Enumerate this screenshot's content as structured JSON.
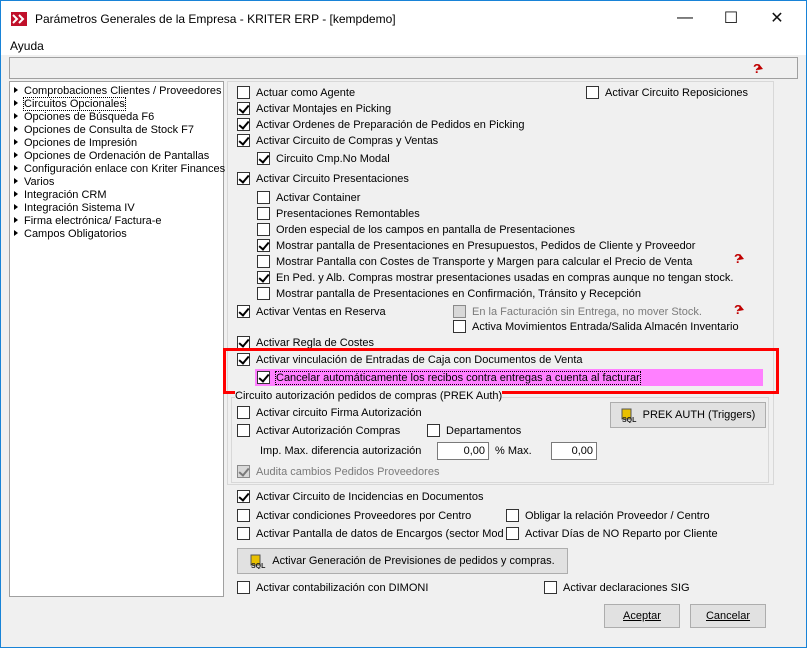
{
  "window": {
    "title": "Parámetros Generales de la Empresa - KRITER ERP - [kempdemo]",
    "minimize": "—",
    "maximize": "☐",
    "close": "✕"
  },
  "menu": {
    "ayuda": "Ayuda"
  },
  "tree": {
    "items": [
      "Comprobaciones Clientes / Proveedores",
      "Circuitos Opcionales",
      "Opciones de Búsqueda F6",
      "Opciones de Consulta de Stock F7",
      "Opciones de Impresión",
      "Opciones de Ordenación de Pantallas",
      "Configuración enlace con Kriter Finances",
      "Varios",
      "Integración CRM",
      "Integración Sistema IV",
      "Firma electrónica/ Factura-e",
      "Campos Obligatorios"
    ],
    "selected_index": 1
  },
  "options": {
    "actuar_agente": "Actuar como Agente",
    "circuito_reposiciones": "Activar Circuito Reposiciones",
    "montajes_picking": "Activar Montajes en Picking",
    "ordenes_picking": "Activar Ordenes de Preparación de Pedidos en Picking",
    "circuito_compras_ventas": "Activar Circuito de Compras y Ventas",
    "circuito_cmp_no_modal": "Circuito Cmp.No Modal",
    "circuito_presentaciones": "Activar Circuito Presentaciones",
    "activar_container": "Activar Container",
    "presentaciones_remontables": "Presentaciones Remontables",
    "orden_especial": "Orden especial de los campos en pantalla de Presentaciones",
    "mostrar_presentaciones_presupuestos": "Mostrar pantalla de Presentaciones en Presupuestos, Pedidos de Cliente y Proveedor",
    "mostrar_costes_transporte": "Mostrar Pantalla con Costes de Transporte y Margen para calcular el Precio de Venta",
    "ped_alb_compras": "En Ped. y Alb. Compras mostrar presentaciones usadas en compras aunque no tengan stock.",
    "mostrar_confirmacion": "Mostrar pantalla de Presentaciones en Confirmación, Tránsito y Recepción",
    "ventas_reserva": "Activar Ventas en Reserva",
    "facturacion_sin_entrega": "En la Facturación sin Entrega, no mover Stock.",
    "movimientos_almacen": "Activa Movimientos Entrada/Salida Almacén Inventario",
    "regla_costes": "Activar Regla de Costes",
    "vinculacion_caja": "Activar vinculación de Entradas de Caja con Documentos de Venta",
    "cancelar_recibos": "Cancelar automáticamente los recibos contra entregas a cuenta al facturar",
    "group_title": "Circuito autorización  pedidos de compras (PREK Auth)",
    "firma_autorizacion": "Activar circuito Firma Autorización",
    "autorizacion_compras": "Activar Autorización Compras",
    "departamentos": "Departamentos",
    "imp_max_label": "Imp. Max. diferencia autorización",
    "imp_max_value": "0,00",
    "pct_max_label": "% Max.",
    "pct_max_value": "0,00",
    "audita_cambios": "Audita cambios Pedidos Proveedores",
    "prek_auth_button": "PREK AUTH  (Triggers)",
    "circuito_incidencias": "Activar Circuito de Incidencias en Documentos",
    "condiciones_proveedores": "Activar condiciones Proveedores por Centro",
    "obligar_relacion": "Obligar la relación Proveedor / Centro",
    "pantalla_encargos": "Activar Pantalla de datos de Encargos (sector Moda",
    "dias_no_reparto": "Activar Días de NO Reparto por Cliente",
    "generacion_previsiones_button": "Activar Generación de Previsiones de pedidos y compras.",
    "contabilizacion_dimoni": "Activar contabilización con DIMONI",
    "declaraciones_sig": "Activar declaraciones SIG"
  },
  "footer": {
    "aceptar": "Aceptar",
    "cancelar": "Cancelar"
  },
  "colors": {
    "highlight": "#ff80ff",
    "red_frame": "#ff0000",
    "window_border": "#1883d7"
  }
}
